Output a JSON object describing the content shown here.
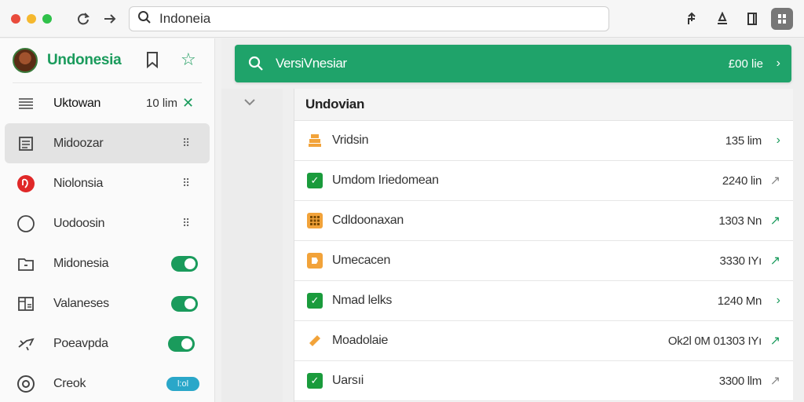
{
  "window": {
    "traffic_colors": [
      "#e94b3c",
      "#f5b82e",
      "#2fc14a"
    ],
    "address_text": "Indoneia"
  },
  "sidebar": {
    "brand": "Undonesia",
    "items": [
      {
        "label": "Uktowan",
        "value": "10 lim",
        "kind": "close",
        "icon": "list-icon"
      },
      {
        "label": "Midoozar",
        "kind": "more",
        "icon": "document-icon",
        "active": true
      },
      {
        "label": "Niolonsia",
        "kind": "more",
        "icon": "red-badge-icon"
      },
      {
        "label": "Uodoosin",
        "kind": "more",
        "icon": "circle-icon"
      },
      {
        "label": "Midonesia",
        "kind": "toggle",
        "icon": "folder-icon",
        "on": true
      },
      {
        "label": "Valaneses",
        "kind": "toggle",
        "icon": "settings-panel-icon",
        "on": true
      },
      {
        "label": "Poeavpda",
        "kind": "toggle",
        "icon": "plane-icon",
        "on": true
      },
      {
        "label": "Creok",
        "kind": "pill",
        "icon": "dial-icon",
        "pill_text": "l:ol"
      }
    ]
  },
  "banner": {
    "text": "VersiVnesiar",
    "right_text": "£00 lie",
    "color": "#1fa36a"
  },
  "panel": {
    "title": "Undovian",
    "rows": [
      {
        "label": "Vridsin",
        "value": "135 lim",
        "icon": "stack-icon",
        "icon_color": "#f2a33a",
        "arrow_color": "green"
      },
      {
        "label": "Umdom Iriedomean",
        "value": "2240 lin",
        "icon": "check-icon",
        "icon_color": "#1a9b3c",
        "arrow_color": "grey"
      },
      {
        "label": "Cdldoonaxan",
        "value": "1303 Nn",
        "icon": "grid-icon",
        "icon_color": "#f2a33a",
        "arrow_color": "green"
      },
      {
        "label": "Umecacen",
        "value": "3330 IYı",
        "icon": "tag-icon",
        "icon_color": "#f2a33a",
        "arrow_color": "green"
      },
      {
        "label": "Nmad lelks",
        "value": "1240 Mn",
        "icon": "check-icon",
        "icon_color": "#1a9b3c",
        "arrow_color": "green"
      },
      {
        "label": "Moadolaie",
        "value": "Ok2l 0M 01303 IYı",
        "icon": "ticket-icon",
        "icon_color": "#f2a33a",
        "arrow_color": "green"
      },
      {
        "label": "Uarsıi",
        "value": "3300 llm",
        "icon": "check-icon",
        "icon_color": "#1a9b3c",
        "arrow_color": "grey"
      }
    ]
  }
}
